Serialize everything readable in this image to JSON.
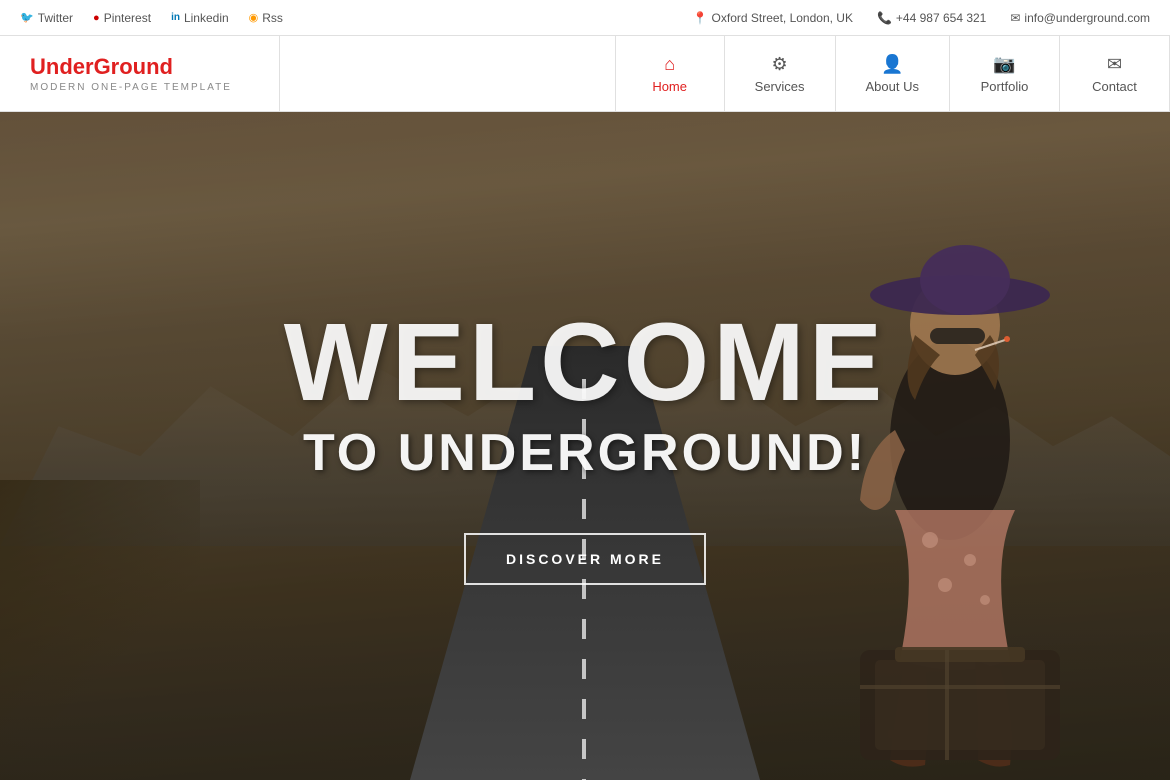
{
  "topbar": {
    "social": [
      {
        "id": "twitter",
        "icon": "𝕏",
        "label": "Twitter"
      },
      {
        "id": "pinterest",
        "icon": "⊕",
        "label": "Pinterest"
      },
      {
        "id": "linkedin",
        "icon": "in",
        "label": "Linkedin"
      },
      {
        "id": "rss",
        "icon": "◉",
        "label": "Rss"
      }
    ],
    "contact": [
      {
        "id": "location",
        "icon": "📍",
        "label": "Oxford Street, London, UK"
      },
      {
        "id": "phone",
        "icon": "📞",
        "label": "+44 987 654 321"
      },
      {
        "id": "email",
        "icon": "✉",
        "label": "info@underground.com"
      }
    ]
  },
  "logo": {
    "title_plain": "Under",
    "title_accent": "Ground",
    "subtitle": "MODERN ONE-PAGE TEMPLATE"
  },
  "nav": {
    "items": [
      {
        "id": "home",
        "icon": "🏠",
        "label": "Home",
        "active": true
      },
      {
        "id": "services",
        "icon": "⚙",
        "label": "Services",
        "active": false
      },
      {
        "id": "about",
        "icon": "👤",
        "label": "About Us",
        "active": false
      },
      {
        "id": "portfolio",
        "icon": "📷",
        "label": "Portfolio",
        "active": false
      },
      {
        "id": "contact",
        "icon": "✉",
        "label": "Contact",
        "active": false
      }
    ]
  },
  "hero": {
    "welcome_text": "WELCOME",
    "subtitle_text": "TO UNDERGROUND!",
    "button_label": "DISCOVER MORE"
  }
}
